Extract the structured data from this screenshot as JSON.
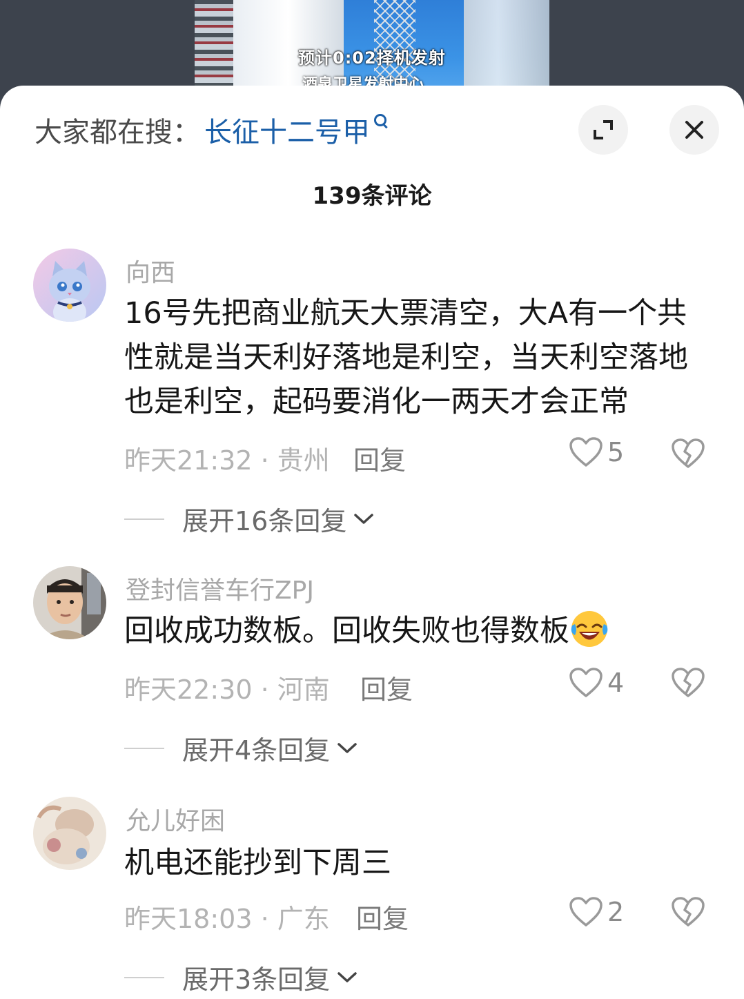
{
  "video": {
    "caption_line1": "预计0:02择机发射",
    "caption_line2": "酒泉卫星发射中心"
  },
  "header": {
    "search_prefix": "大家都在搜：",
    "search_term": "长征十二号甲",
    "comment_count": "139条评论"
  },
  "comments": [
    {
      "user": "向西",
      "text": "16号先把商业航天大票清空，大A有一个共性就是当天利好落地是利空，当天利空落地也是利空，起码要消化一两天才会正常",
      "time_location": "昨天21:32 · 贵州",
      "reply_label": "回复",
      "likes": "5",
      "expand_label": "展开16条回复"
    },
    {
      "user": "登封信誉车行ZPJ",
      "text": "回收成功数板。回收失败也得数板",
      "emoji": "laughing-crying-emoji",
      "time_location": "昨天22:30 · 河南",
      "reply_label": "回复",
      "likes": "4",
      "expand_label": "展开4条回复"
    },
    {
      "user": "允儿好困",
      "text": "机电还能抄到下周三",
      "time_location": "昨天18:03 · 广东",
      "reply_label": "回复",
      "likes": "2",
      "expand_label": "展开3条回复"
    }
  ]
}
